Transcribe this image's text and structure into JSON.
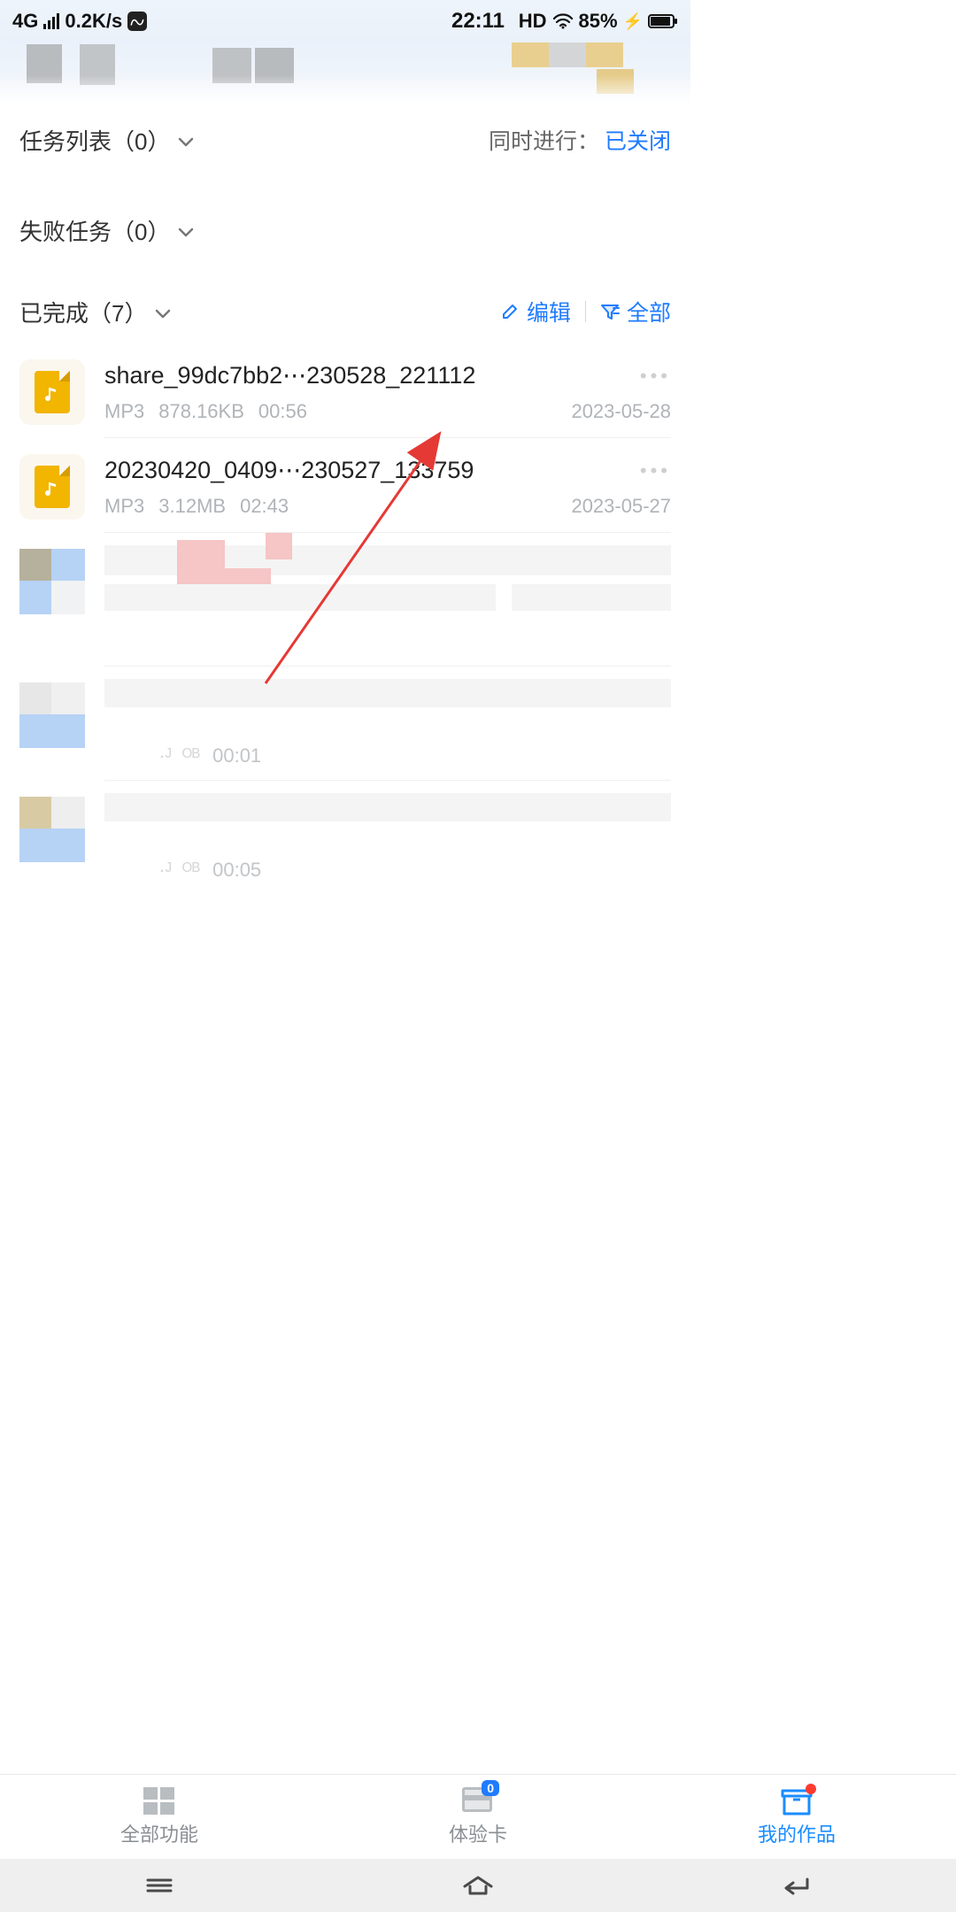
{
  "status": {
    "network": "4G",
    "speed": "0.2K/s",
    "time": "22:11",
    "hd": "HD",
    "battery": "85%"
  },
  "sections": {
    "tasks": {
      "label": "任务列表（0）"
    },
    "concurrent": {
      "label": "同时进行：",
      "value": "已关闭"
    },
    "failed": {
      "label": "失败任务（0）"
    },
    "completed": {
      "label": "已完成（7）"
    },
    "edit": "编辑",
    "filter": "全部"
  },
  "files": [
    {
      "title": "share_99dc7bb2⋯230528_221112",
      "format": "MP3",
      "size": "878.16KB",
      "duration": "00:56",
      "date": "2023-05-28"
    },
    {
      "title": "20230420_0409⋯230527_133759",
      "format": "MP3",
      "size": "3.12MB",
      "duration": "02:43",
      "date": "2023-05-27"
    }
  ],
  "blurred": {
    "row1_dur": "00:01",
    "row2_dur": "00:05"
  },
  "tabs": {
    "all": "全部功能",
    "card": "体验卡",
    "card_badge": "0",
    "mine": "我的作品"
  }
}
